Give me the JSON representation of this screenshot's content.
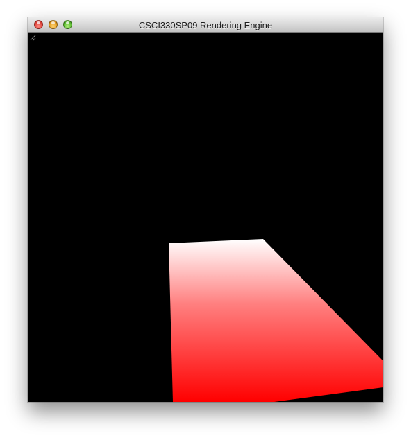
{
  "window": {
    "title": "CSCI330SP09 Rendering Engine",
    "buttons": {
      "close": "close-icon",
      "minimize": "minimize-icon",
      "zoom": "zoom-icon"
    }
  },
  "canvas": {
    "background_color": "#000000",
    "shape": {
      "name": "rendered-quad",
      "gradient_top_color": "#ffffff",
      "gradient_bottom_color": "#ff0000"
    }
  },
  "colors": {
    "close": "#e0443b",
    "minimize": "#e5a023",
    "zoom": "#5fbf33"
  }
}
